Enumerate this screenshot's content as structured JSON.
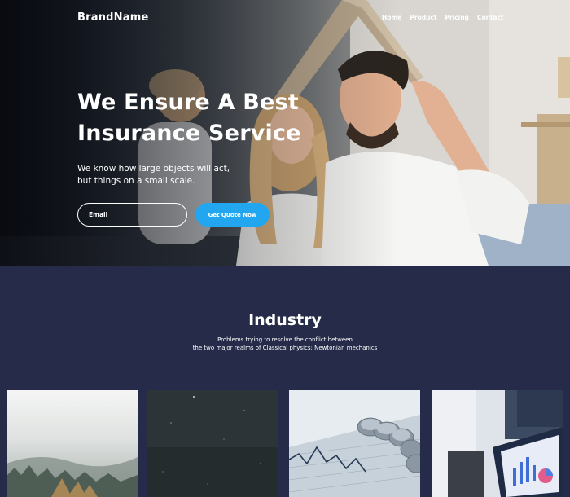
{
  "header": {
    "brand": "BrandName",
    "nav": [
      "Home",
      "Product",
      "Pricing",
      "Contact"
    ]
  },
  "hero": {
    "title_line1": "We Ensure A Best",
    "title_line2": "Insurance Service",
    "subtitle_line1": "We know how large objects will act,",
    "subtitle_line2": "but things on a small scale.",
    "email_placeholder": "Email",
    "cta_label": "Get Quote Now",
    "accent_color": "#23a6f0"
  },
  "industry": {
    "title": "Industry",
    "subtitle_line1": "Problems trying to resolve the conflict between",
    "subtitle_line2": "the two major realms of Classical physics: Newtonian mechanics",
    "background_color": "#252b48",
    "cards": [
      {
        "image": "misty-forest-image"
      },
      {
        "image": "night-sky-image"
      },
      {
        "image": "coins-chart-image"
      },
      {
        "image": "laptop-dashboard-image"
      }
    ]
  }
}
